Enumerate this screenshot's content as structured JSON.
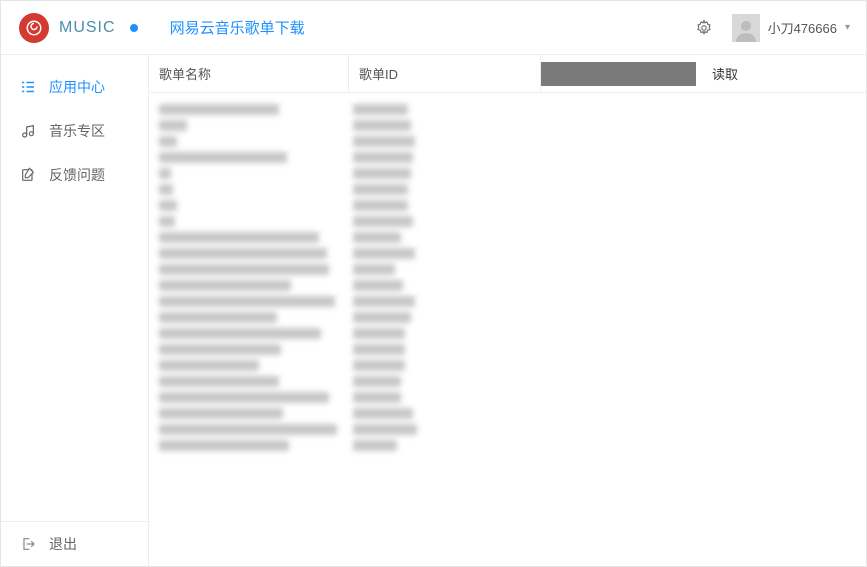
{
  "header": {
    "brand": "MUSIC",
    "title": "网易云音乐歌单下载",
    "username": "小刀476666"
  },
  "sidebar": {
    "items": [
      {
        "label": "应用中心",
        "icon": "grid-icon",
        "active": true
      },
      {
        "label": "音乐专区",
        "icon": "music-icon",
        "active": false
      },
      {
        "label": "反馈问题",
        "icon": "edit-icon",
        "active": false
      }
    ],
    "logout_label": "退出"
  },
  "table": {
    "col_name": "歌单名称",
    "col_id": "歌单ID",
    "id_input_value": "",
    "read_label": "读取",
    "rows": [
      {
        "name_w": 120,
        "id_w": 55
      },
      {
        "name_w": 28,
        "id_w": 58
      },
      {
        "name_w": 18,
        "id_w": 62
      },
      {
        "name_w": 128,
        "id_w": 60
      },
      {
        "name_w": 12,
        "id_w": 58
      },
      {
        "name_w": 14,
        "id_w": 55
      },
      {
        "name_w": 18,
        "id_w": 55
      },
      {
        "name_w": 16,
        "id_w": 60
      },
      {
        "name_w": 160,
        "id_w": 48
      },
      {
        "name_w": 168,
        "id_w": 62
      },
      {
        "name_w": 170,
        "id_w": 42
      },
      {
        "name_w": 132,
        "id_w": 50
      },
      {
        "name_w": 176,
        "id_w": 62
      },
      {
        "name_w": 118,
        "id_w": 58
      },
      {
        "name_w": 162,
        "id_w": 52
      },
      {
        "name_w": 122,
        "id_w": 52
      },
      {
        "name_w": 100,
        "id_w": 52
      },
      {
        "name_w": 120,
        "id_w": 48
      },
      {
        "name_w": 170,
        "id_w": 48
      },
      {
        "name_w": 124,
        "id_w": 60
      },
      {
        "name_w": 178,
        "id_w": 64
      },
      {
        "name_w": 130,
        "id_w": 44
      }
    ]
  }
}
